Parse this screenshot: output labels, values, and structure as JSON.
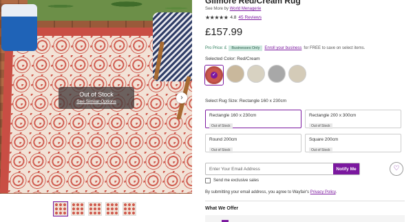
{
  "gallery": {
    "out_of_stock_title": "Out of Stock",
    "see_similar_link": "See Similar Options",
    "next_arrow": "›",
    "thumbnail_count": 5
  },
  "product": {
    "title": "Gilmore Red/Cream Rug",
    "see_more_prefix": "See More by",
    "brand": "World Menagerie",
    "stars": "★★★★★",
    "rating": "4.8",
    "reviews": "45 Reviews",
    "rating_value": 4.8,
    "price": "£157.99"
  },
  "pro_price": {
    "label": "Pro Price: £",
    "badge": "Businesses Only",
    "enroll_link": "Enroll your business",
    "suffix": "for FREE to save on select items."
  },
  "color": {
    "label": "Selected Color: Red/Cream",
    "swatches": [
      {
        "name": "Red/Cream",
        "color": "#c9574d",
        "selected": true
      },
      {
        "name": "Beige",
        "color": "#c9b89c",
        "selected": false
      },
      {
        "name": "Cream",
        "color": "#d8d2c2",
        "selected": false
      },
      {
        "name": "Gray",
        "color": "#a8a8a8",
        "selected": false
      },
      {
        "name": "Light Beige",
        "color": "#d4cbb8",
        "selected": false
      }
    ]
  },
  "size": {
    "label": "Select Rug Size: Rectangle 160 x 230cm",
    "options": [
      {
        "name": "Rectangle 160 x 230cm",
        "stock": "Out of Stock"
      },
      {
        "name": "Rectangle 200 x 300cm",
        "stock": "Out of Stock"
      },
      {
        "name": "Round 200cm",
        "stock": "Out of Stock"
      },
      {
        "name": "Square 200cm",
        "stock": "Out of Stock"
      }
    ]
  },
  "notify": {
    "email_placeholder": "Enter Your Email Address",
    "button": "Notify Me",
    "heart_icon": "♡",
    "exclusive_sales": "Send me exclusive sales",
    "consent_prefix": "By submitting your email address, you agree to Wayfair's",
    "privacy_link": "Privacy Policy",
    "consent_suffix": "."
  },
  "offers": {
    "heading": "What We Offer"
  },
  "colors": {
    "accent": "#7b189f",
    "badge_bg": "#cde8de"
  }
}
